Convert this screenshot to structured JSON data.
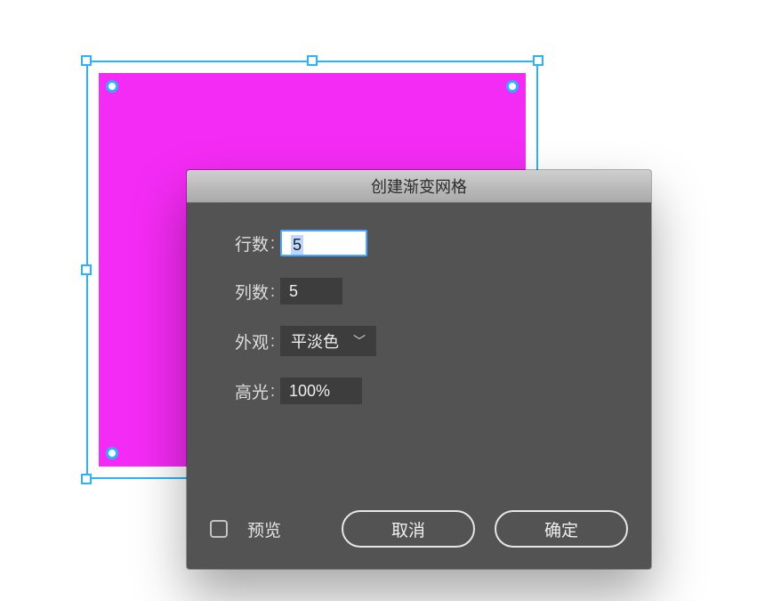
{
  "canvas": {
    "shape_fill": "#f42bf4",
    "selection_color": "#2bb2ff"
  },
  "dialog": {
    "title": "创建渐变网格",
    "rows": {
      "rows_label": "行数",
      "rows_value": "5",
      "cols_label": "列数",
      "cols_value": "5",
      "appearance_label": "外观",
      "appearance_value": "平淡色",
      "highlight_label": "高光",
      "highlight_value": "100%"
    },
    "preview_label": "预览",
    "preview_checked": false,
    "buttons": {
      "cancel": "取消",
      "ok": "确定"
    }
  }
}
